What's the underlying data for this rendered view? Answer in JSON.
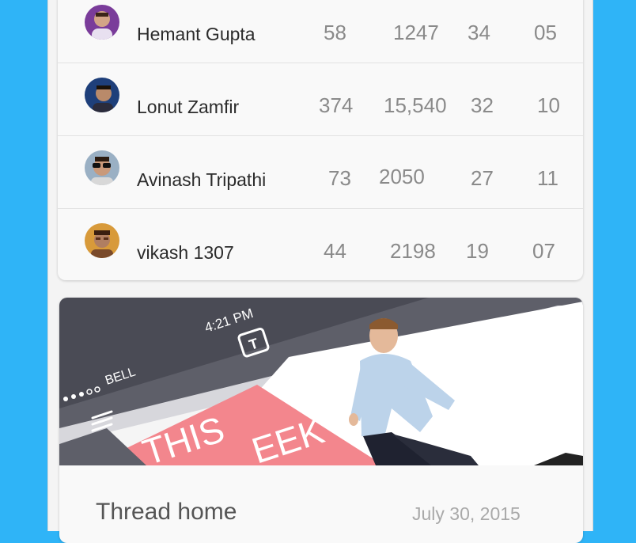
{
  "leaderboard": {
    "rows": [
      {
        "name": "Hemant Gupta",
        "stats": [
          "58",
          "1247",
          "34",
          "05"
        ],
        "avatar": "user-avatar-purple"
      },
      {
        "name": "Lonut Zamfir",
        "stats": [
          "374",
          "15,540",
          "32",
          "10"
        ],
        "avatar": "user-avatar-navy"
      },
      {
        "name": "Avinash Tripathi",
        "stats": [
          "73",
          "2050",
          "27",
          "11"
        ],
        "avatar": "user-avatar-sunglasses"
      },
      {
        "name": "vikash 1307",
        "stats": [
          "44",
          "2198",
          "19",
          "07"
        ],
        "avatar": "user-avatar-gold"
      }
    ]
  },
  "post": {
    "title": "Thread home",
    "date": "July 30, 2015",
    "image": {
      "status_carrier": "BELL",
      "status_time": "4:21 PM",
      "logo_letter": "T",
      "banner_text": "THIS",
      "banner_text_2": "EEK"
    }
  },
  "colors": {
    "background": "#2fb4f7",
    "card": "#f9f9f9",
    "banner_pink": "#f3868d",
    "name_text": "#2b2b2b",
    "stat_text": "#8a8a8a"
  }
}
